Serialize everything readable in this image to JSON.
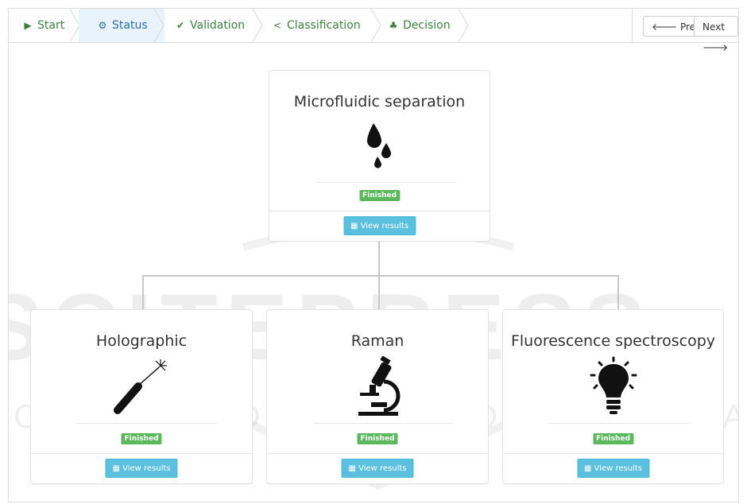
{
  "wizard": {
    "steps": [
      {
        "label": "Start",
        "icon": "play-circle-icon"
      },
      {
        "label": "Status",
        "icon": "cogs-icon"
      },
      {
        "label": "Validation",
        "icon": "check-circle-icon"
      },
      {
        "label": "Classification",
        "icon": "share-icon"
      },
      {
        "label": "Decision",
        "icon": "sitemap-icon"
      }
    ],
    "active_step": "Status",
    "prev_label": "Prev",
    "next_label": "Next"
  },
  "cards": {
    "root": {
      "title": "Microfluidic separation",
      "icon": "droplets-icon",
      "status": "Finished",
      "button": "View results"
    },
    "children": [
      {
        "title": "Holographic",
        "icon": "laser-pointer-icon",
        "status": "Finished",
        "button": "View results"
      },
      {
        "title": "Raman",
        "icon": "microscope-icon",
        "status": "Finished",
        "button": "View results"
      },
      {
        "title": "Fluorescence spectroscopy",
        "icon": "lightbulb-icon",
        "status": "Finished",
        "button": "View results"
      }
    ]
  },
  "watermark": {
    "line1": "SCITEPRESS",
    "line2": "SCIENCE AND TECHNOLOGY PUBLICATIONS"
  },
  "colors": {
    "success": "#5cb85c",
    "info": "#5bc0de",
    "step_text": "#3f7f3f",
    "active_step": "#2a6ea8"
  }
}
